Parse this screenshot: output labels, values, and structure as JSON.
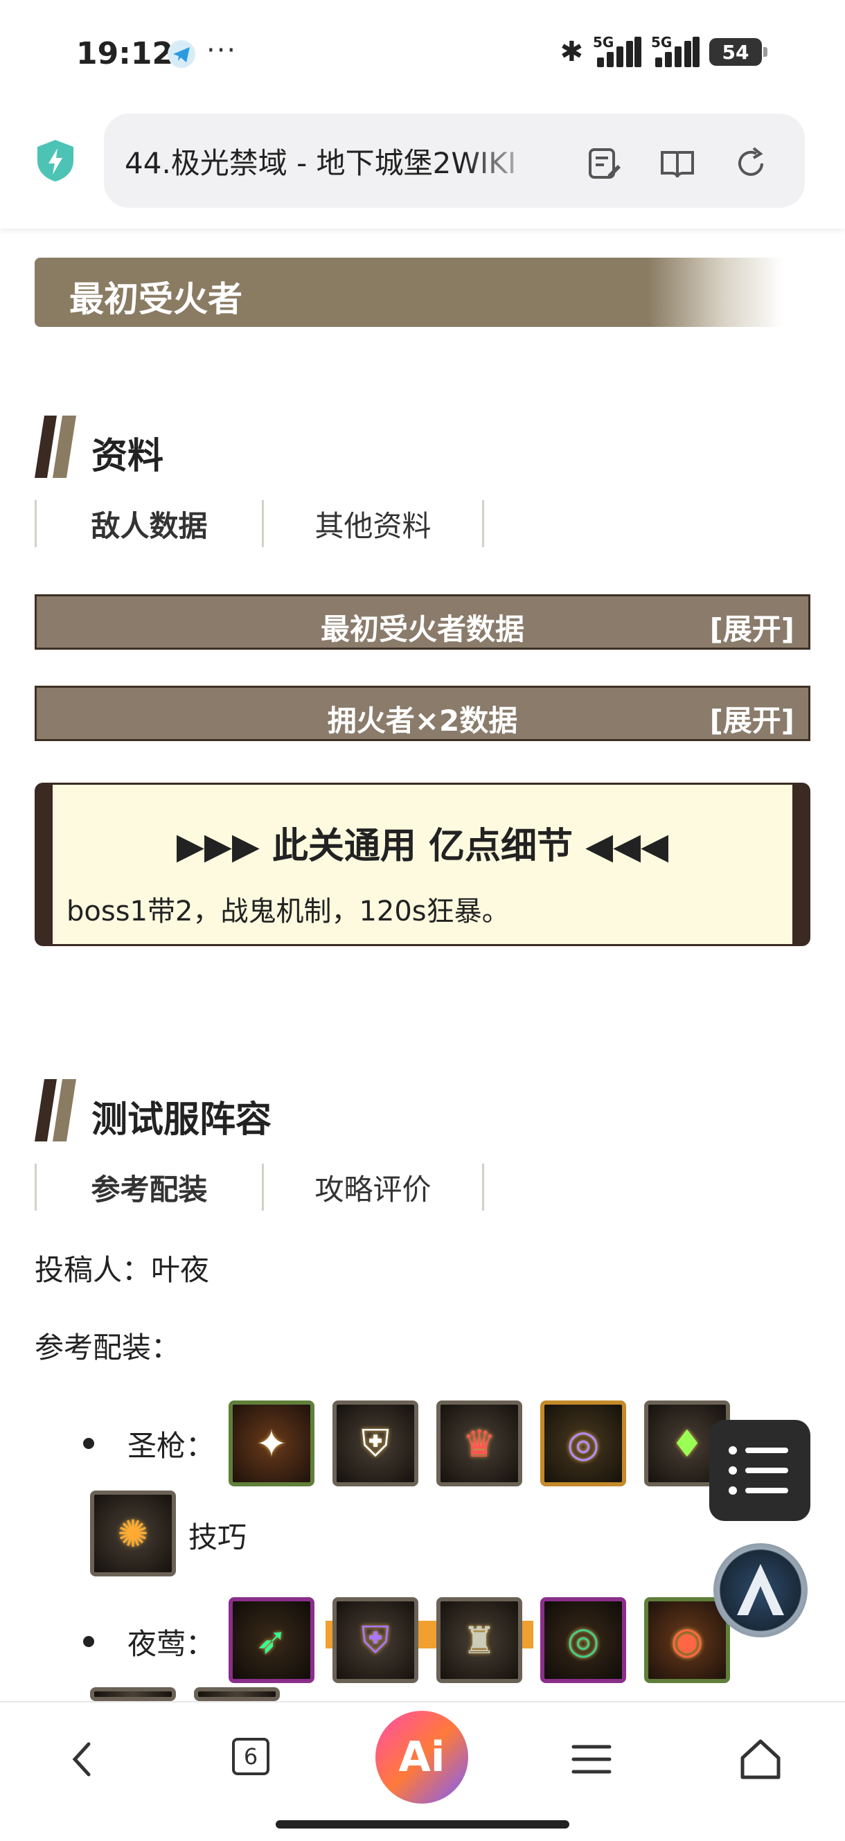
{
  "status_bar": {
    "time": "19:12",
    "dots": "···",
    "sig1_label": "5G",
    "sig2_label": "5G",
    "battery": "54"
  },
  "browser": {
    "address": "44.极光禁域 - 地下城堡2WIKI"
  },
  "page": {
    "banner_title": "最初受火者",
    "section1": {
      "title": "资料",
      "tabs": [
        "敌人数据",
        "其他资料"
      ],
      "collapsibles": [
        {
          "title": "最初受火者数据",
          "expand": "[展开]"
        },
        {
          "title": "拥火者×2数据",
          "expand": "[展开]"
        }
      ]
    },
    "note": {
      "title": "▶▶▶ 此关通用 亿点细节 ◀◀◀",
      "body": "boss1带2，战鬼机制，120s狂暴。"
    },
    "section2": {
      "title": "测试服阵容",
      "tabs": [
        "参考配装",
        "攻略评价"
      ],
      "contributor": "投稿人：叶夜",
      "loadout_label": "参考配装：",
      "rows": [
        {
          "label": "圣枪：",
          "extra": "技巧"
        },
        {
          "label": "夜莺："
        }
      ]
    }
  },
  "bottom_nav": {
    "tabs_count": "6",
    "ai_label": "Ai"
  }
}
